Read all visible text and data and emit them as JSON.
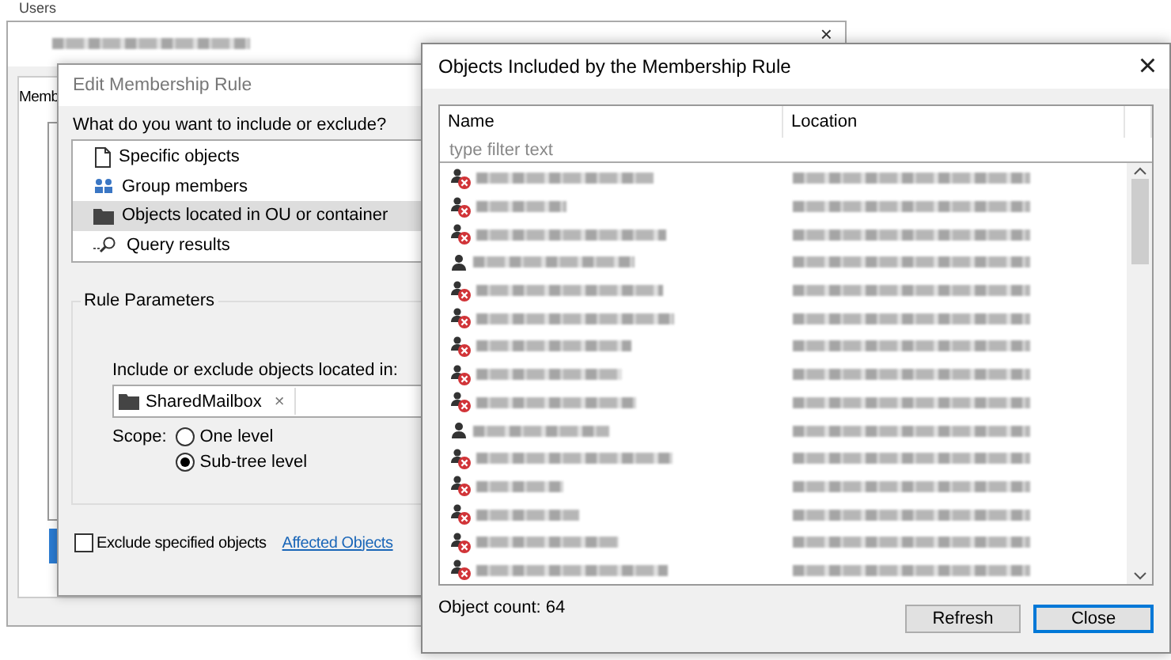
{
  "background_window": {
    "label": "Users",
    "tab": "Memb",
    "close": "×"
  },
  "edit_rule_dialog": {
    "title": "Edit Membership Rule",
    "question": "What do you want to include or exclude?",
    "options": [
      {
        "label": "Specific objects",
        "kind": "document",
        "selected": false
      },
      {
        "label": "Group members",
        "kind": "group",
        "selected": false
      },
      {
        "label": "Objects located in OU or container",
        "kind": "folder",
        "selected": true
      },
      {
        "label": "Query results",
        "kind": "query",
        "selected": false
      }
    ],
    "group_title": "Rule Parameters",
    "location_label": "Include or exclude objects located in:",
    "location_chip": "SharedMailbox",
    "chip_remove": "×",
    "scope_label": "Scope:",
    "scope_options": [
      {
        "label": "One level",
        "selected": false
      },
      {
        "label": "Sub-tree level",
        "selected": true
      }
    ],
    "exclude": {
      "label": "Exclude specified objects",
      "checked": false
    },
    "link": "Affected Objects"
  },
  "objects_dialog": {
    "title": "Objects Included by the Membership Rule",
    "close": "×",
    "columns": [
      "Name",
      "Location"
    ],
    "filter": {
      "placeholder": "type filter text"
    },
    "rows": [
      {
        "kind": "disabled-user"
      },
      {
        "kind": "disabled-user"
      },
      {
        "kind": "disabled-user"
      },
      {
        "kind": "user"
      },
      {
        "kind": "disabled-user"
      },
      {
        "kind": "disabled-user"
      },
      {
        "kind": "disabled-user"
      },
      {
        "kind": "disabled-user"
      },
      {
        "kind": "disabled-user"
      },
      {
        "kind": "user"
      },
      {
        "kind": "disabled-user"
      },
      {
        "kind": "disabled-user"
      },
      {
        "kind": "disabled-user"
      },
      {
        "kind": "disabled-user"
      },
      {
        "kind": "disabled-user"
      }
    ],
    "count": "Object count: 64",
    "buttons": [
      {
        "label": "Refresh",
        "focused": false
      },
      {
        "label": "Close",
        "focused": true
      }
    ]
  }
}
